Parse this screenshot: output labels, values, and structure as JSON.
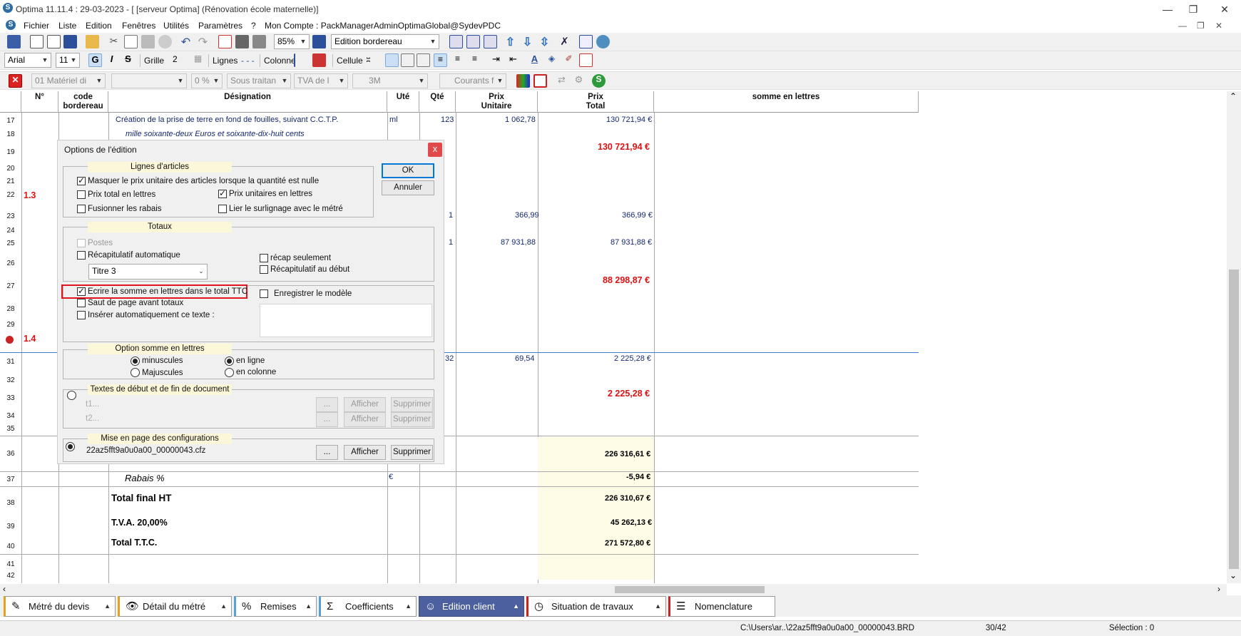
{
  "window": {
    "title": "Optima 11.11.4 : 29-03-2023 - [ [serveur Optima] (Rénovation école maternelle)]"
  },
  "menu": {
    "items": [
      "Fichier",
      "Liste",
      "Edition",
      "Fenêtres",
      "Utilités",
      "Paramètres",
      "?",
      "Mon Compte : PackManagerAdminOptimaGlobal@SydevPDC"
    ]
  },
  "toolbar1": {
    "zoom": "85%",
    "view": "Edition bordereau"
  },
  "toolbar2": {
    "font": "Arial",
    "size": "11",
    "grille_label": "Grille",
    "grille_value": "2",
    "lignes_label": "Lignes",
    "colonne_label": "Colonne",
    "cellule_label": "Cellule"
  },
  "toolbar3": {
    "materiel": "01  Matériel di",
    "pct": "0 %",
    "sous": "Sous traitan",
    "tva": "TVA de l",
    "three": "3M",
    "courants": "Courants f"
  },
  "grid": {
    "headers": {
      "num": "N°",
      "code": "code bordereau",
      "designation": "Désignation",
      "ute": "Uté",
      "qte": "Qté",
      "pu": "Prix Unitaire",
      "pt": "Prix Total",
      "lettres": "somme en lettres"
    },
    "row_numbers": [
      "17",
      "18",
      "19",
      "20",
      "21",
      "22",
      "23",
      "24",
      "25",
      "26",
      "27",
      "28",
      "29",
      "30",
      "31",
      "32",
      "33",
      "34",
      "35",
      "36",
      "37",
      "38",
      "39",
      "40",
      "41",
      "42"
    ],
    "r17_desig": "Création de la prise de terre en fond de fouilles, suivant C.C.T.P.",
    "r17_ute": "ml",
    "r17_qte": "123",
    "r17_pu": "1 062,78",
    "r17_pt": "130 721,94 €",
    "r18_desig": "mille soixante-deux Euros et  soixante-dix-huit cents",
    "r19_pt": "130 721,94 €",
    "r22_num": "1.3",
    "r23_qte": "1",
    "r23_pu": "366,99",
    "r23_pt": "366,99 €",
    "r25_qte": "1",
    "r25_pu": "87 931,88",
    "r25_pt": "87 931,88 €",
    "r27_pt": "88 298,87 €",
    "r30_num": "1.4",
    "r31_qte": "32",
    "r31_pu": "69,54",
    "r31_pt": "2 225,28 €",
    "r33_pt": "2 225,28 €",
    "r36_pt": "226 316,61 €",
    "r37_desig": "Rabais %",
    "r37_ute": "€",
    "r37_pt": "-5,94 €",
    "r38_desig": "Total final HT",
    "r38_pt": "226 310,67 €",
    "r39_desig": "T.V.A. 20,00%",
    "r39_pt": "45 262,13 €",
    "r40_desig": "Total  T.T.C.",
    "r40_pt": "271 572,80 €"
  },
  "dialog": {
    "title": "Options de l'édition",
    "close": "x",
    "ok": "OK",
    "cancel": "Annuler",
    "group_lignes": "Lignes d'articles",
    "masquer": "Masquer le prix unitaire des articles lorsque la quantité est nulle",
    "prix_total_lettres": "Prix total en lettres",
    "prix_unit_lettres": "Prix unitaires en lettres",
    "fusionner": "Fusionner les rabais",
    "lier": "Lier le surlignage avec le métré",
    "group_totaux": "Totaux",
    "postes": "Postes",
    "recap_auto": "Récapitulatif automatique",
    "recap_seul": "récap seulement",
    "recap_debut": "Récapitulatif au début",
    "titre_select": "Titre 3",
    "ecrire": "Ecrire la somme en lettres dans le total TTC",
    "enregistrer": "Enregistrer le modèle",
    "saut": "Saut de page avant totaux",
    "inserer": "Insérer automatiquement ce texte :",
    "group_option": "Option somme en lettres",
    "minuscules": "minuscules",
    "majuscules": "Majuscules",
    "en_ligne": "en ligne",
    "en_colonne": "en colonne",
    "group_textes": "Textes de début et de fin de document",
    "t1": "t1...",
    "t2": "t2...",
    "ellipsis": "...",
    "afficher": "Afficher",
    "supprimer": "Supprimer",
    "group_mise": "Mise en page des configurations",
    "config_file": "22az5fft9a0u0a00_00000043.cfz"
  },
  "tabs": [
    {
      "label": "Métré du devis",
      "icon": "✎"
    },
    {
      "label": "Détail du métré",
      "icon": "👁"
    },
    {
      "label": "Remises",
      "icon": "%"
    },
    {
      "label": "Coefficients",
      "icon": "Σ"
    },
    {
      "label": "Edition client",
      "icon": "☺"
    },
    {
      "label": "Situation de travaux",
      "icon": "◷"
    },
    {
      "label": "Nomenclature",
      "icon": "☰"
    }
  ],
  "status": {
    "path": "C:\\Users\\ar..\\22az5fft9a0u0a00_00000043.BRD",
    "pos": "30/42",
    "selection": "Sélection : 0"
  },
  "colors": {
    "accent_red": "#d11111",
    "text_blue": "#14286e",
    "active_tab": "#4c5f9e",
    "highlight_box": "#e0161e"
  }
}
